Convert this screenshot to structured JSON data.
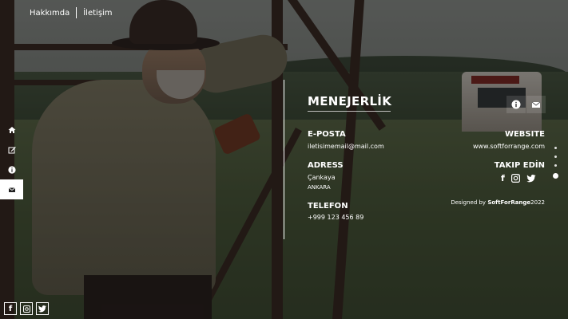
{
  "nav": {
    "about": "Hakkımda",
    "contact": "İletişim"
  },
  "sidebar": {
    "items": [
      {
        "name": "home-icon",
        "active": false
      },
      {
        "name": "edit-icon",
        "active": false
      },
      {
        "name": "info-icon",
        "active": false
      },
      {
        "name": "mail-icon",
        "active": true
      }
    ]
  },
  "social_bottom": [
    "facebook-icon",
    "instagram-icon",
    "twitter-icon"
  ],
  "content": {
    "title": "MENEJERLİK",
    "email_label": "E-POSTA",
    "email_value": "iletisimemail@mail.com",
    "address_label": "ADRESS",
    "address_line1": "Çankaya",
    "address_line2": "ANKARA",
    "phone_label": "TELEFON",
    "phone_value": "+999 123 456 89",
    "website_label": "WEBSITE",
    "website_value": "www.softforrange.com",
    "follow_label": "TAKIP EDİN"
  },
  "credits": {
    "prefix": "Designed by ",
    "brand": "SoftForRange",
    "year": "2022"
  },
  "colors": {
    "accent": "#ffffff",
    "overlay": "rgba(0,0,0,0.40)"
  }
}
